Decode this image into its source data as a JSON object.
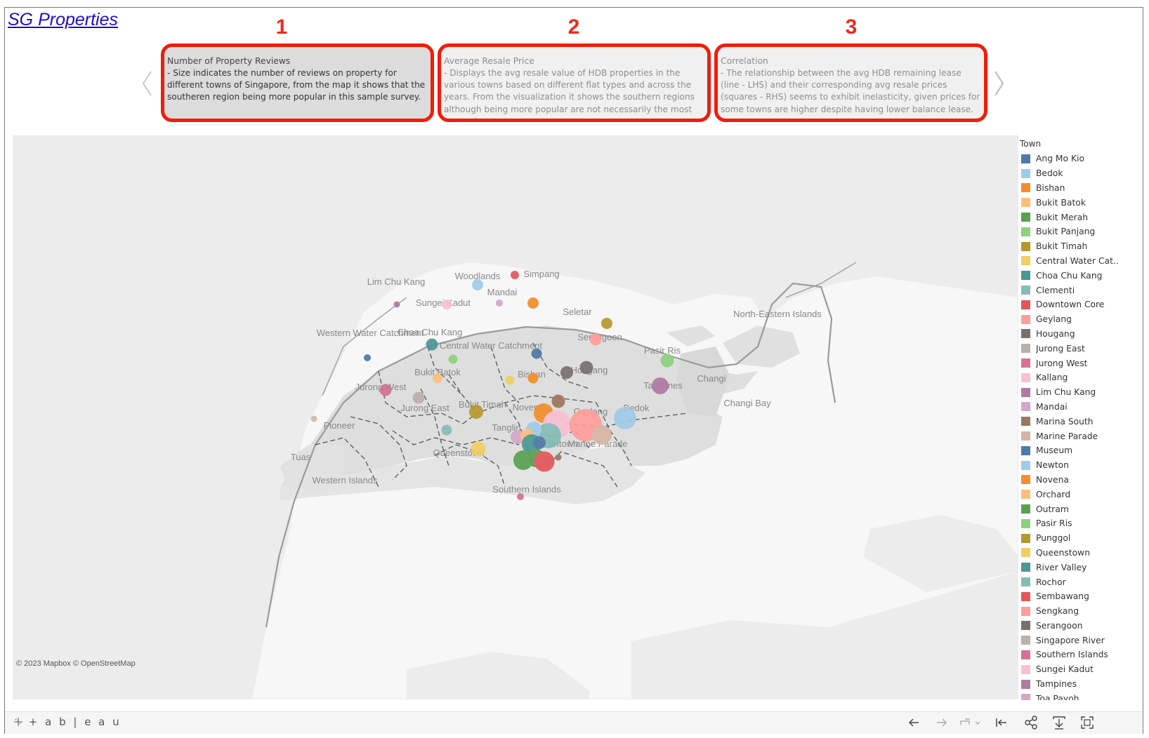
{
  "title": "SG Properties",
  "story_points": [
    {
      "number": "1",
      "title": "Number of Property Reviews",
      "body": "- Size indicates the number of reviews on property for different towns of Singapore, from the map it shows that the southeren region being more popular in this sample survey.",
      "active": true
    },
    {
      "number": "2",
      "title": "Average Resale Price",
      "body": "- Displays the avg resale value of HDB properties in the various towns based on different flat types and across the years. From the visualization it shows the southern regions although being more popular are not necessarily the most expensive.",
      "active": false
    },
    {
      "number": "3",
      "title": "Correlation",
      "body": "- The relationship between the avg HDB remaining lease (line - LHS) and their corresponding avg resale prices (squares - RHS) seems to exhibit inelasticity, given prices for some towns are higher despite having lower balance lease.",
      "active": false
    }
  ],
  "map": {
    "place_labels": [
      "Woodlands",
      "Simpang",
      "Lim Chu Kang",
      "Mandai",
      "Sungei Kadut",
      "Seletar",
      "Western Water Catchment",
      "Choa Chu Kang",
      "Central Water Catchment",
      "Serangoon",
      "Pasir Ris",
      "North-Eastern Islands",
      "Bukit Batok",
      "Bishan",
      "Hougang",
      "Tampines",
      "Changi",
      "Jurong West",
      "Changi Bay",
      "Jurong East",
      "Bukit Timah",
      "Novena",
      "Geylang",
      "Bedok",
      "Pioneer",
      "Tanglin",
      "Marine Parade",
      "Queenstown",
      "Downtown",
      "Tuas",
      "Western Islands",
      "Southern Islands"
    ],
    "attribution": "© 2023 Mapbox  © OpenStreetMap"
  },
  "legend": {
    "title": "Town",
    "items": [
      {
        "label": "Ang Mo Kio",
        "color": "#4e79a7"
      },
      {
        "label": "Bedok",
        "color": "#a0cbe8"
      },
      {
        "label": "Bishan",
        "color": "#f28e2b"
      },
      {
        "label": "Bukit Batok",
        "color": "#ffbe7d"
      },
      {
        "label": "Bukit Merah",
        "color": "#59a14f"
      },
      {
        "label": "Bukit Panjang",
        "color": "#8cd17d"
      },
      {
        "label": "Bukit Timah",
        "color": "#b6992d"
      },
      {
        "label": "Central Water Cat..",
        "color": "#f1ce63"
      },
      {
        "label": "Choa Chu Kang",
        "color": "#499894"
      },
      {
        "label": "Clementi",
        "color": "#86bcb6"
      },
      {
        "label": "Downtown Core",
        "color": "#e15759"
      },
      {
        "label": "Geylang",
        "color": "#ff9d9a"
      },
      {
        "label": "Hougang",
        "color": "#79706e"
      },
      {
        "label": "Jurong East",
        "color": "#bab0ac"
      },
      {
        "label": "Jurong West",
        "color": "#d37295"
      },
      {
        "label": "Kallang",
        "color": "#fabfd2"
      },
      {
        "label": "Lim Chu Kang",
        "color": "#b07aa1"
      },
      {
        "label": "Mandai",
        "color": "#d4a6c8"
      },
      {
        "label": "Marina South",
        "color": "#9d7660"
      },
      {
        "label": "Marine Parade",
        "color": "#d7b5a6"
      },
      {
        "label": "Museum",
        "color": "#4e79a7"
      },
      {
        "label": "Newton",
        "color": "#a0cbe8"
      },
      {
        "label": "Novena",
        "color": "#f28e2b"
      },
      {
        "label": "Orchard",
        "color": "#ffbe7d"
      },
      {
        "label": "Outram",
        "color": "#59a14f"
      },
      {
        "label": "Pasir Ris",
        "color": "#8cd17d"
      },
      {
        "label": "Punggol",
        "color": "#b6992d"
      },
      {
        "label": "Queenstown",
        "color": "#f1ce63"
      },
      {
        "label": "River Valley",
        "color": "#499894"
      },
      {
        "label": "Rochor",
        "color": "#86bcb6"
      },
      {
        "label": "Sembawang",
        "color": "#e15759"
      },
      {
        "label": "Sengkang",
        "color": "#ff9d9a"
      },
      {
        "label": "Serangoon",
        "color": "#79706e"
      },
      {
        "label": "Singapore River",
        "color": "#bab0ac"
      },
      {
        "label": "Southern Islands",
        "color": "#d37295"
      },
      {
        "label": "Sungei Kadut",
        "color": "#fabfd2"
      },
      {
        "label": "Tampines",
        "color": "#b07aa1"
      },
      {
        "label": "Toa Payoh",
        "color": "#d4a6c8"
      }
    ]
  },
  "toolbar": {
    "brand": "+ a b | e a u",
    "icons": [
      "undo-icon",
      "redo-icon",
      "revert-icon",
      "go-to-start-icon",
      "share-icon",
      "download-icon",
      "fullscreen-icon"
    ]
  }
}
